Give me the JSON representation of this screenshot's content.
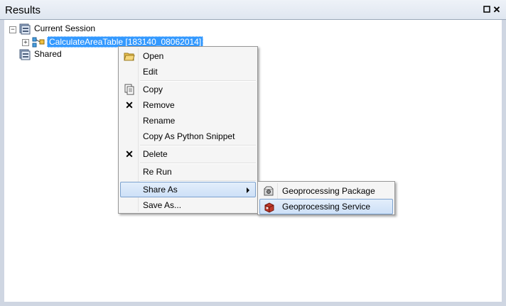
{
  "window": {
    "title": "Results"
  },
  "tree": {
    "current_session": "Current Session",
    "result_item": "CalculateAreaTable [183140_08062014]",
    "shared": "Shared"
  },
  "context_menu": {
    "open": "Open",
    "edit": "Edit",
    "copy": "Copy",
    "remove": "Remove",
    "rename": "Rename",
    "copy_python": "Copy As Python Snippet",
    "delete": "Delete",
    "rerun": "Re Run",
    "share_as": "Share As",
    "save_as": "Save As..."
  },
  "submenu": {
    "package": "Geoprocessing Package",
    "service": "Geoprocessing Service"
  },
  "colors": {
    "selection": "#3399ff",
    "menu_hover": "#cde0f7",
    "menu_border": "#979797"
  }
}
